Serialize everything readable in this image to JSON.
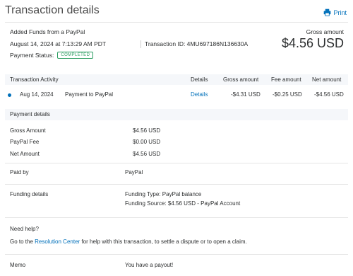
{
  "header": {
    "title": "Transaction details",
    "print_label": "Print"
  },
  "summary": {
    "description": "Added Funds from a PayPal",
    "datetime": "August 14, 2024 at 7:13:29 AM PDT",
    "transaction_id_label": "Transaction ID: 4MU697186N136630A",
    "status_label": "Payment Status:",
    "status_badge": "COMPLETED",
    "gross_label": "Gross amount",
    "gross_value": "$4.56 USD"
  },
  "activity": {
    "headers": {
      "activity": "Transaction Activity",
      "details": "Details",
      "gross": "Gross amount",
      "fee": "Fee amount",
      "net": "Net amount"
    },
    "row": {
      "date": "Aug 14, 2024",
      "description": "Payment to PayPal",
      "details": "Details",
      "gross": "-$4.31 USD",
      "fee": "-$0.25 USD",
      "net": "-$4.56 USD"
    }
  },
  "payment_details": {
    "heading": "Payment details",
    "gross_label": "Gross Amount",
    "gross_value": "$4.56 USD",
    "fee_label": "PayPal Fee",
    "fee_value": "$0.00 USD",
    "net_label": "Net Amount",
    "net_value": "$4.56 USD"
  },
  "paid_by": {
    "label": "Paid by",
    "value": "PayPal"
  },
  "funding": {
    "label": "Funding details",
    "type": "Funding Type: PayPal balance",
    "source": "Funding Source: $4.56 USD - PayPal Account"
  },
  "help": {
    "heading": "Need help?",
    "prefix": "Go to the",
    "link": "Resolution Center",
    "suffix": "for help with this transaction, to settle a dispute or to open a claim."
  },
  "memo": {
    "label": "Memo",
    "value": "You have a payout!"
  }
}
